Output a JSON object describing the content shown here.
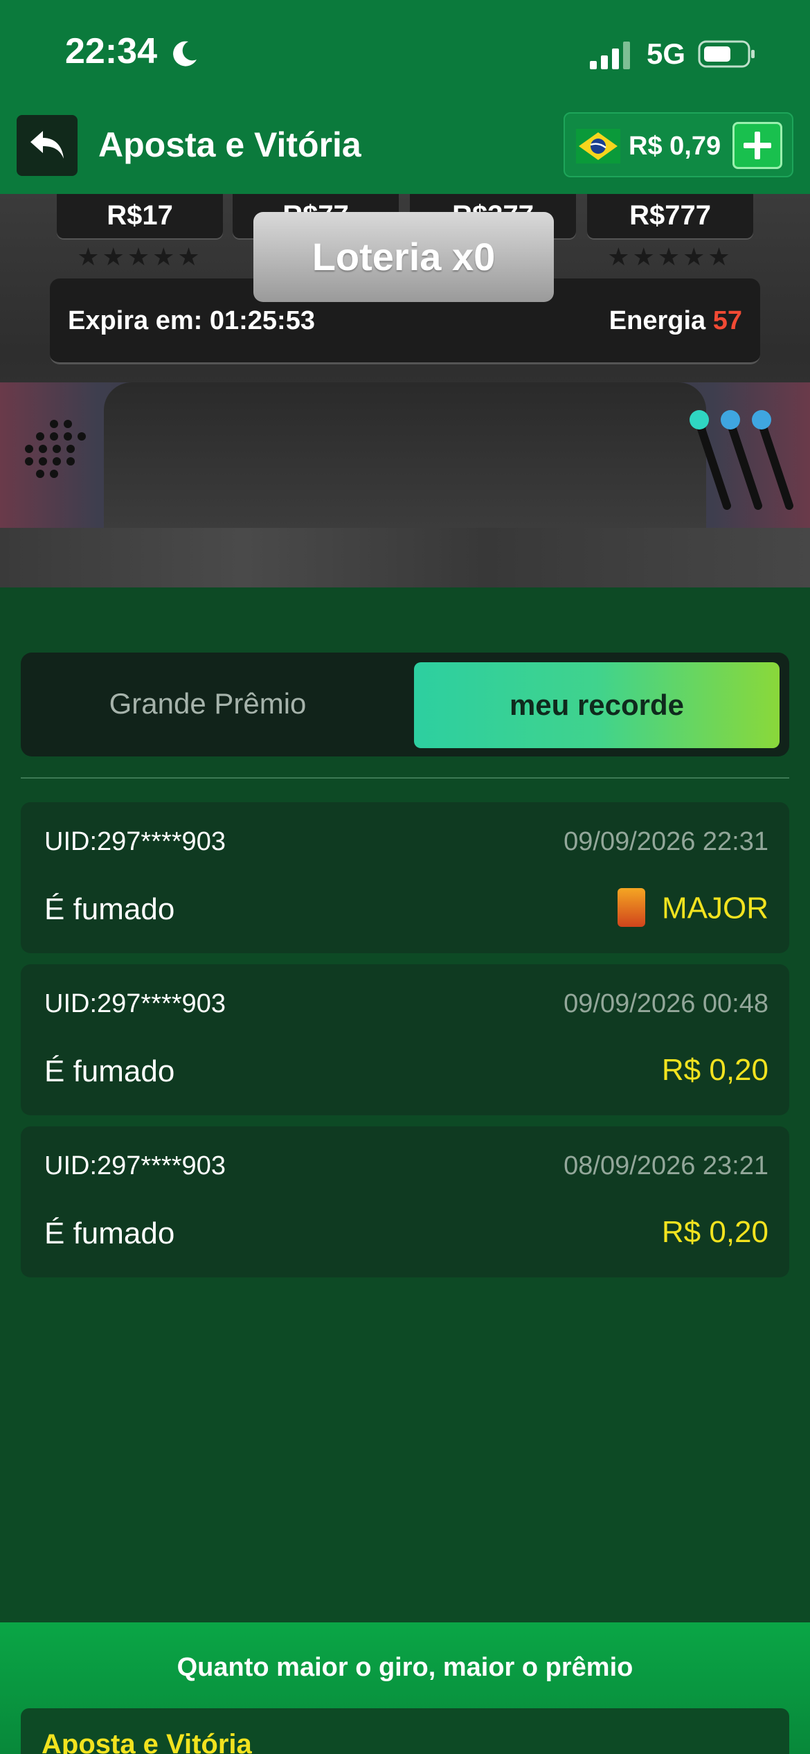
{
  "status_bar": {
    "time": "22:34",
    "network": "5G"
  },
  "header": {
    "title": "Aposta e Vitória",
    "balance": "R$ 0,79"
  },
  "machine": {
    "tiers": [
      {
        "label": "R$17",
        "stars": 0
      },
      {
        "label": "R$77",
        "stars": 0
      },
      {
        "label": "R$377",
        "stars": 1
      },
      {
        "label": "R$777",
        "stars": 0
      }
    ],
    "expire_text": "Expira em: 01:25:53",
    "energy_label": "Energia",
    "energy_value": "57",
    "lottery_button": "Loteria x0"
  },
  "tabs": {
    "grand": "Grande Prêmio",
    "record": "meu recorde",
    "active": "record"
  },
  "records": [
    {
      "uid": "UID:297****903",
      "date": "09/09/2026 22:31",
      "status": "É fumado",
      "prize": "MAJOR",
      "icon": "wild-icon"
    },
    {
      "uid": "UID:297****903",
      "date": "09/09/2026 00:48",
      "status": "É fumado",
      "prize": "R$ 0,20"
    },
    {
      "uid": "UID:297****903",
      "date": "08/09/2026 23:21",
      "status": "É fumado",
      "prize": "R$ 0,20"
    }
  ],
  "footer": {
    "text": "Quanto maior o giro, maior o prêmio",
    "card_title": "Aposta e Vitória"
  },
  "colors": {
    "accent": "#0b7a3c",
    "prize": "#f2e31f",
    "energy": "#f24a34"
  }
}
